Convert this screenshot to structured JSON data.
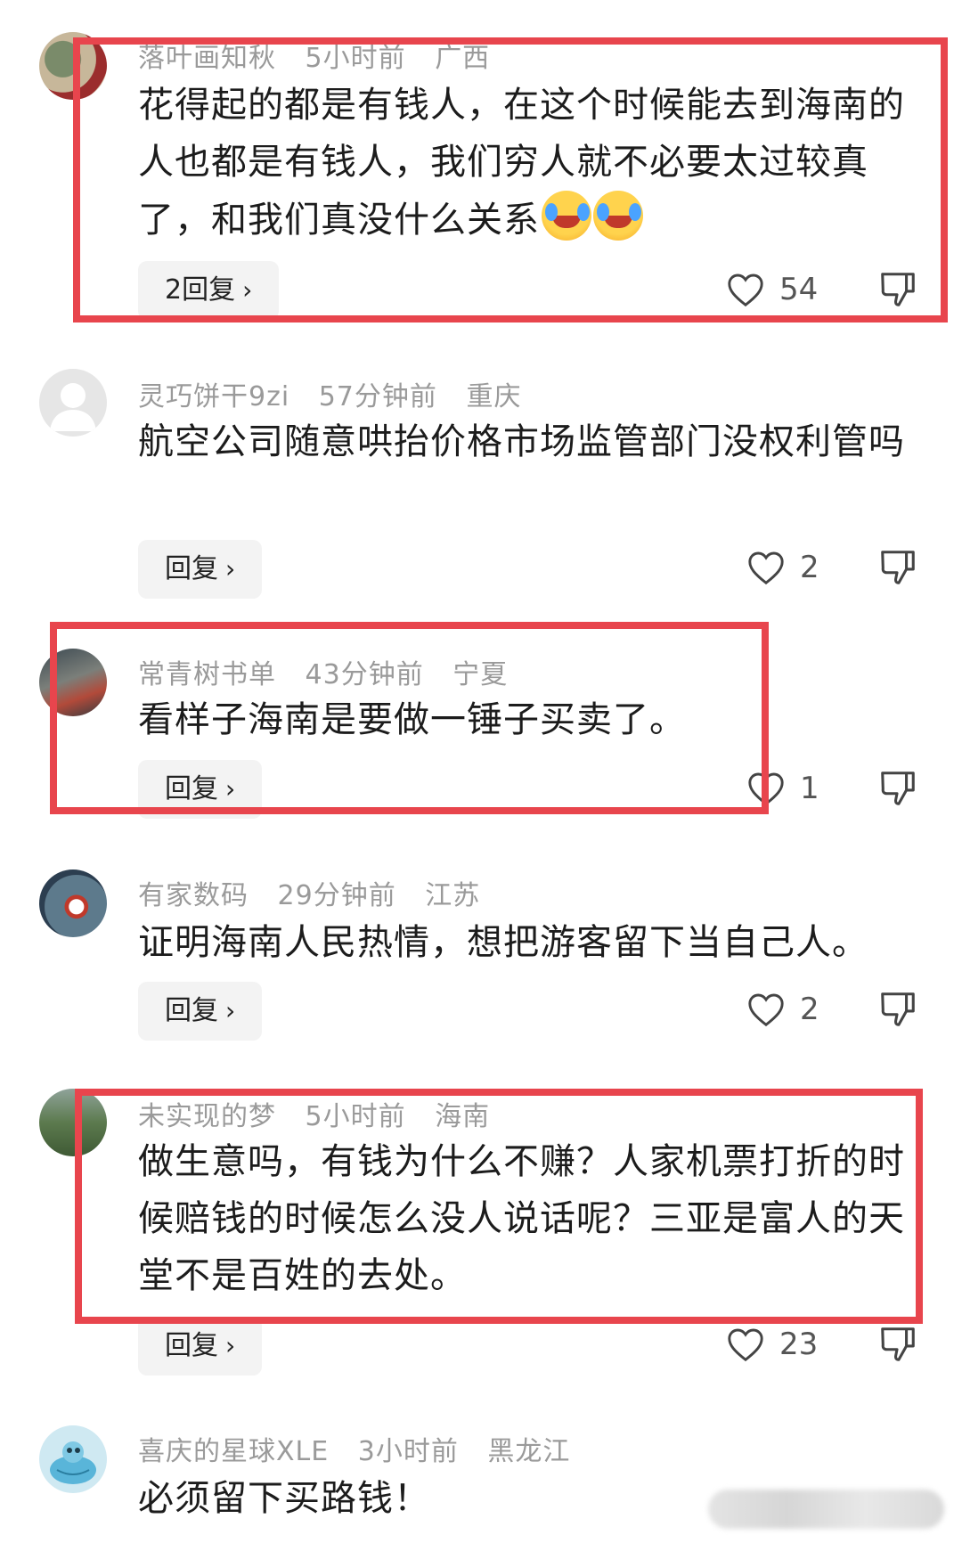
{
  "comments": [
    {
      "username": "落叶画知秋",
      "time": "5小时前",
      "location": "广西",
      "text": "花得起的都是有钱人，在这个时候能去到海南的人也都是有钱人，我们穷人就不必要太过较真了，和我们真没什么关系",
      "emoji": "laugh-cry-emoji",
      "reply_label": "2回复",
      "likes": "54"
    },
    {
      "username": "灵巧饼干9zi",
      "time": "57分钟前",
      "location": "重庆",
      "text": "航空公司随意哄抬价格市场监管部门没权利管吗",
      "reply_label": "回复",
      "likes": "2"
    },
    {
      "username": "常青树书单",
      "time": "43分钟前",
      "location": "宁夏",
      "text": "看样子海南是要做一锤子买卖了。",
      "reply_label": "回复",
      "likes": "1"
    },
    {
      "username": "有家数码",
      "time": "29分钟前",
      "location": "江苏",
      "text": "证明海南人民热情，想把游客留下当自己人。",
      "reply_label": "回复",
      "likes": "2"
    },
    {
      "username": "未实现的梦",
      "time": "5小时前",
      "location": "海南",
      "text": "做生意吗，有钱为什么不赚？人家机票打折的时候赔钱的时候怎么没人说话呢？三亚是富人的天堂不是百姓的去处。",
      "reply_label": "回复",
      "likes": "23"
    },
    {
      "username": "喜庆的星球XLE",
      "time": "3小时前",
      "location": "黑龙江",
      "text": "必须留下买路钱！"
    }
  ],
  "icons": {
    "like": "heart-outline-icon",
    "dislike": "thumbs-down-icon",
    "chevron": "chevron-right-icon"
  },
  "colors": {
    "highlight_border": "#e8454d",
    "meta_text": "#9a9a9a",
    "reply_bg": "#f3f3f3"
  }
}
